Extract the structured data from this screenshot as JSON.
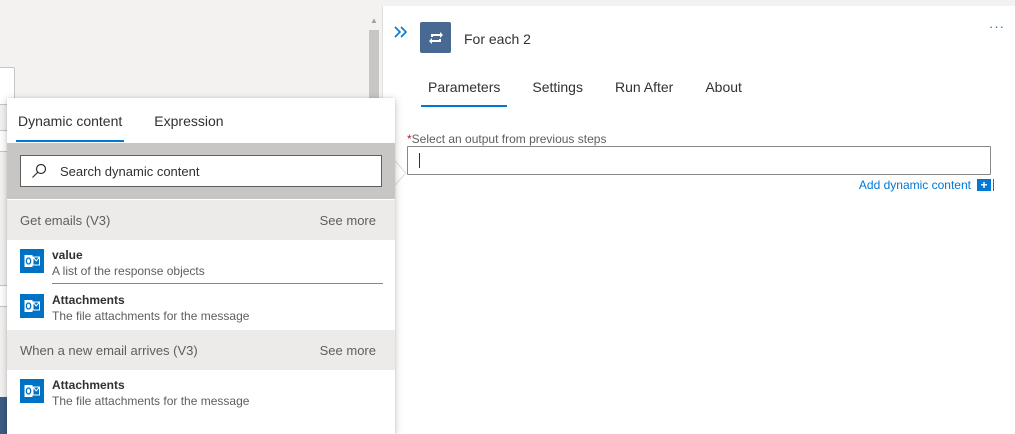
{
  "panel": {
    "title": "For each 2",
    "more_label": "···",
    "tabs": [
      {
        "label": "Parameters",
        "active": true
      },
      {
        "label": "Settings",
        "active": false
      },
      {
        "label": "Run After",
        "active": false
      },
      {
        "label": "About",
        "active": false
      }
    ],
    "field": {
      "required_mark": "*",
      "label": "Select an output from previous steps",
      "value": ""
    },
    "add_dynamic_label": "Add dynamic content",
    "add_dynamic_plus": "+"
  },
  "flyout": {
    "tabs": [
      {
        "label": "Dynamic content",
        "active": true
      },
      {
        "label": "Expression",
        "active": false
      }
    ],
    "search_placeholder": "Search dynamic content",
    "sections": [
      {
        "title": "Get emails (V3)",
        "see_more": "See more",
        "items": [
          {
            "title": "value",
            "description": "A list of the response objects",
            "icon": "outlook-icon"
          },
          {
            "title": "Attachments",
            "description": "The file attachments for the message",
            "icon": "outlook-icon"
          }
        ]
      },
      {
        "title": "When a new email arrives (V3)",
        "see_more": "See more",
        "items": [
          {
            "title": "Attachments",
            "description": "The file attachments for the message",
            "icon": "outlook-icon"
          }
        ]
      }
    ]
  },
  "colors": {
    "accent": "#0078d4",
    "action_badge": "#486991",
    "outlook": "#0072c6",
    "required": "#a4262c"
  }
}
